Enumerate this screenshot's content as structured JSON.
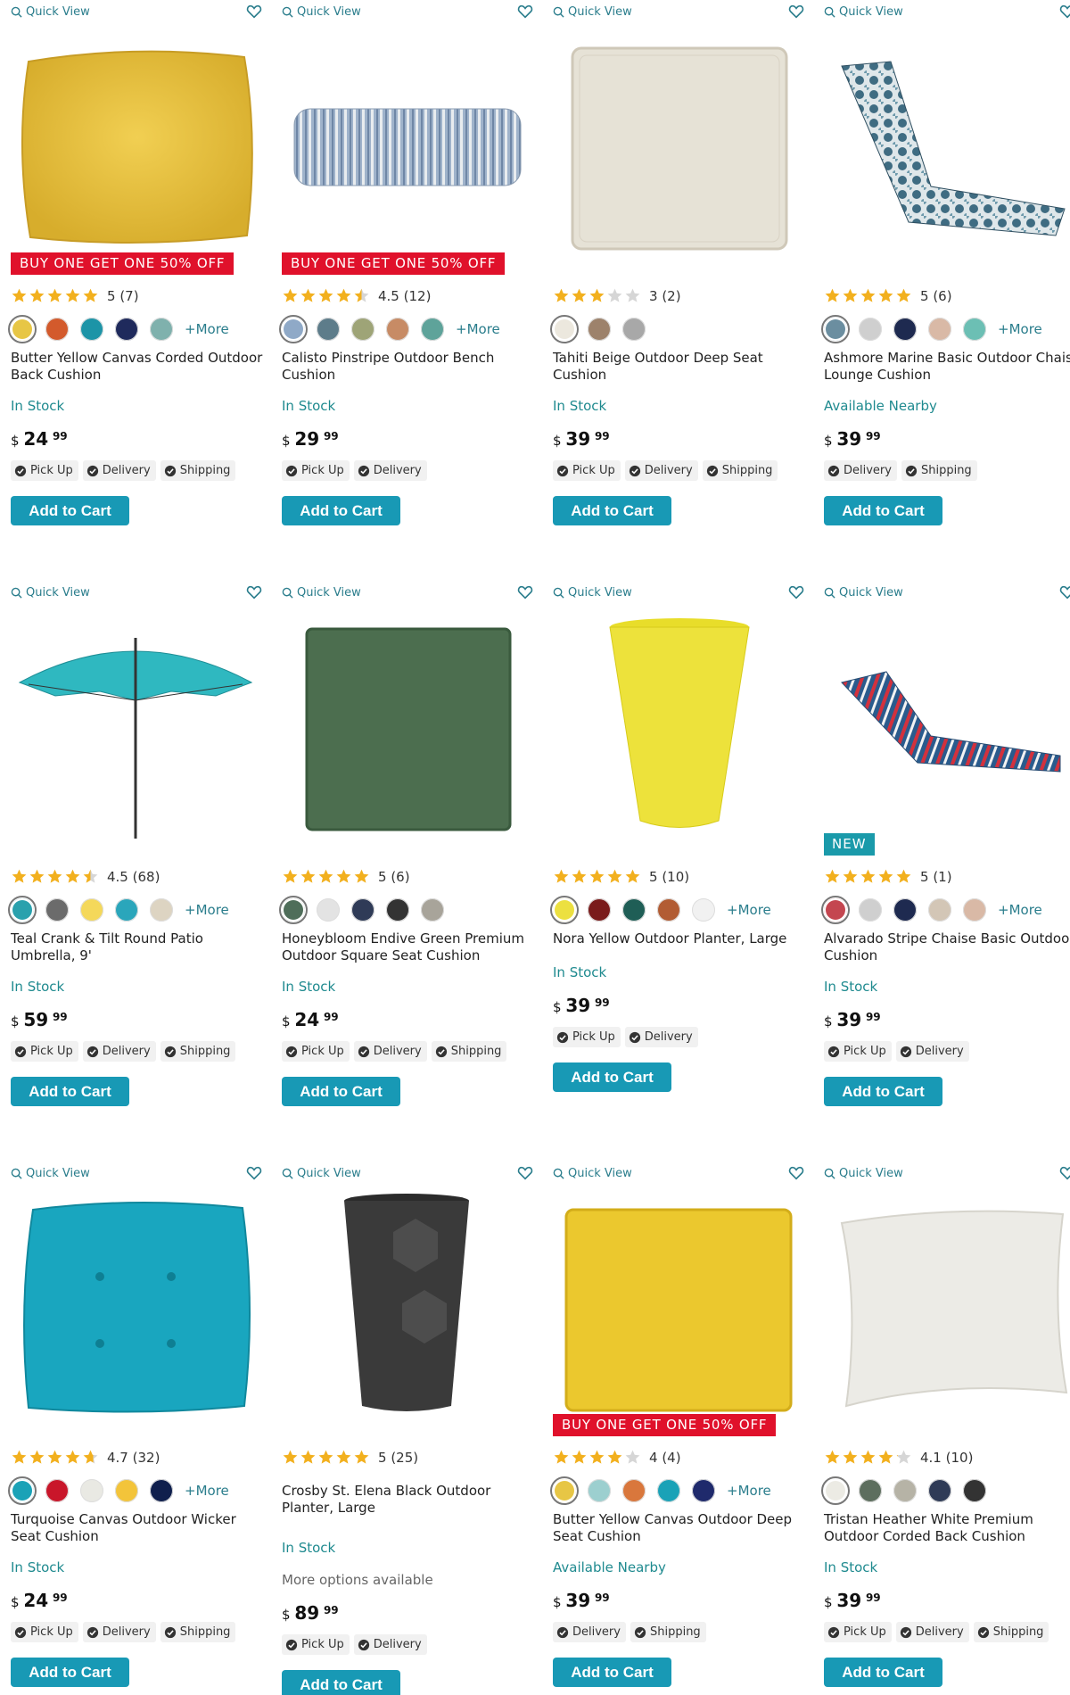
{
  "common": {
    "quick_view": "Quick View",
    "add_to_cart": "Add to Cart"
  },
  "products": [
    {
      "name": "Butter Yellow Canvas Corded Outdoor Back Cushion",
      "rating": "5",
      "reviews": "(7)",
      "stars": 5,
      "swatches": [
        "#e7c645",
        "#d35a2c",
        "#1c94a7",
        "#1f2a5c",
        "#7fb1ad"
      ],
      "more": "+More",
      "stock": "In Stock",
      "dollars": "24",
      "cents": "99",
      "fulfillment": [
        "Pick Up",
        "Delivery",
        "Shipping"
      ],
      "badge": "BUY ONE GET ONE 50% OFF",
      "badge_type": "promo",
      "image": "yellow-back-cushion"
    },
    {
      "name": "Calisto Pinstripe Outdoor Bench Cushion",
      "rating": "4.5",
      "reviews": "(12)",
      "stars": 4.5,
      "swatches": [
        "#8fa9c7",
        "#5d7c8a",
        "#9ea477",
        "#c78b65",
        "#5ea39a"
      ],
      "more": "+More",
      "stock": "In Stock",
      "dollars": "29",
      "cents": "99",
      "fulfillment": [
        "Pick Up",
        "Delivery"
      ],
      "badge": "BUY ONE GET ONE 50% OFF",
      "badge_type": "promo",
      "image": "bench-cushion"
    },
    {
      "name": "Tahiti Beige Outdoor Deep Seat Cushion",
      "rating": "3",
      "reviews": "(2)",
      "stars": 3,
      "swatches": [
        "#ece8de",
        "#9d826b",
        "#a8a8a8"
      ],
      "more": "",
      "stock": "In Stock",
      "dollars": "39",
      "cents": "99",
      "fulfillment": [
        "Pick Up",
        "Delivery",
        "Shipping"
      ],
      "badge": "",
      "badge_type": "",
      "image": "beige-seat-cushion"
    },
    {
      "name": "Ashmore Marine Basic Outdoor Chaise Lounge Cushion",
      "rating": "5",
      "reviews": "(6)",
      "stars": 5,
      "swatches": [
        "#6b8ea0",
        "#cfcfcf",
        "#1e2a50",
        "#d9b9a6",
        "#6cbfb4"
      ],
      "more": "+More",
      "stock": "Available Nearby",
      "dollars": "39",
      "cents": "99",
      "fulfillment": [
        "Delivery",
        "Shipping"
      ],
      "badge": "",
      "badge_type": "",
      "image": "chaise-marine"
    },
    {
      "name": "Teal Crank & Tilt Round Patio Umbrella, 9'",
      "rating": "4.5",
      "reviews": "(68)",
      "stars": 4.5,
      "swatches": [
        "#2aa1ad",
        "#6b6b6b",
        "#f4d85a",
        "#2aa6bb",
        "#ddd4c2"
      ],
      "more": "+More",
      "stock": "In Stock",
      "dollars": "59",
      "cents": "99",
      "fulfillment": [
        "Pick Up",
        "Delivery",
        "Shipping"
      ],
      "badge": "",
      "badge_type": "",
      "image": "umbrella"
    },
    {
      "name": "Honeybloom Endive Green Premium Outdoor Square Seat Cushion",
      "rating": "5",
      "reviews": "(6)",
      "stars": 5,
      "swatches": [
        "#4f6e5a",
        "#e3e3e3",
        "#2f3b57",
        "#333333",
        "#a8a49a"
      ],
      "more": "",
      "stock": "In Stock",
      "dollars": "24",
      "cents": "99",
      "fulfillment": [
        "Pick Up",
        "Delivery",
        "Shipping"
      ],
      "badge": "",
      "badge_type": "",
      "image": "green-cushion"
    },
    {
      "name": "Nora Yellow Outdoor Planter, Large",
      "rating": "5",
      "reviews": "(10)",
      "stars": 5,
      "swatches": [
        "#ece040",
        "#7a1b1b",
        "#1f5e56",
        "#b25c33",
        "#f1f1f1"
      ],
      "more": "+More",
      "stock": "In Stock",
      "dollars": "39",
      "cents": "99",
      "fulfillment": [
        "Pick Up",
        "Delivery"
      ],
      "badge": "",
      "badge_type": "",
      "image": "yellow-planter"
    },
    {
      "name": "Alvarado Stripe Chaise Basic Outdoor Cushion",
      "rating": "5",
      "reviews": "(1)",
      "stars": 5,
      "swatches": [
        "#c44650",
        "#cfcfcf",
        "#1e2a50",
        "#d3c6b6",
        "#d9b9a6"
      ],
      "more": "+More",
      "stock": "In Stock",
      "dollars": "39",
      "cents": "99",
      "fulfillment": [
        "Pick Up",
        "Delivery"
      ],
      "badge": "NEW",
      "badge_type": "new",
      "image": "chaise-stripe"
    },
    {
      "name": "Turquoise Canvas Outdoor Wicker Seat Cushion",
      "rating": "4.7",
      "reviews": "(32)",
      "stars": 4.7,
      "swatches": [
        "#1aa2b7",
        "#c9162a",
        "#e9e9e3",
        "#f3c43a",
        "#0f1f4d"
      ],
      "more": "+More",
      "stock": "In Stock",
      "dollars": "24",
      "cents": "99",
      "fulfillment": [
        "Pick Up",
        "Delivery",
        "Shipping"
      ],
      "badge": "",
      "badge_type": "",
      "image": "turquoise-cushion"
    },
    {
      "name": "Crosby St. Elena Black Outdoor Planter, Large",
      "rating": "5",
      "reviews": "(25)",
      "stars": 5,
      "swatches": [],
      "more": "",
      "stock": "In Stock",
      "dollars": "89",
      "cents": "99",
      "extra": "More options available",
      "fulfillment": [
        "Pick Up",
        "Delivery"
      ],
      "badge": "",
      "badge_type": "",
      "image": "black-planter"
    },
    {
      "name": "Butter Yellow Canvas Outdoor Deep Seat Cushion",
      "rating": "4",
      "reviews": "(4)",
      "stars": 4,
      "swatches": [
        "#e7c645",
        "#9ccfcf",
        "#d9773c",
        "#1aa2b7",
        "#1f2a6c"
      ],
      "more": "+More",
      "stock": "Available Nearby",
      "dollars": "39",
      "cents": "99",
      "fulfillment": [
        "Delivery",
        "Shipping"
      ],
      "badge": "BUY ONE GET ONE 50% OFF",
      "badge_type": "promo",
      "image": "yellow-seat-cushion"
    },
    {
      "name": "Tristan Heather White Premium Outdoor Corded Back Cushion",
      "rating": "4.1",
      "reviews": "(10)",
      "stars": 4.1,
      "swatches": [
        "#ecebe4",
        "#5d6e5e",
        "#b6b3a6",
        "#2f3b57",
        "#333333"
      ],
      "more": "",
      "stock": "In Stock",
      "dollars": "39",
      "cents": "99",
      "fulfillment": [
        "Pick Up",
        "Delivery",
        "Shipping"
      ],
      "badge": "",
      "badge_type": "",
      "image": "white-pillow"
    }
  ],
  "colors": {
    "accent": "#1899b5",
    "teal_text": "#2a7d8c",
    "promo": "#e0112b",
    "new_badge": "#1a9aaa",
    "star": "#f2b01e"
  }
}
